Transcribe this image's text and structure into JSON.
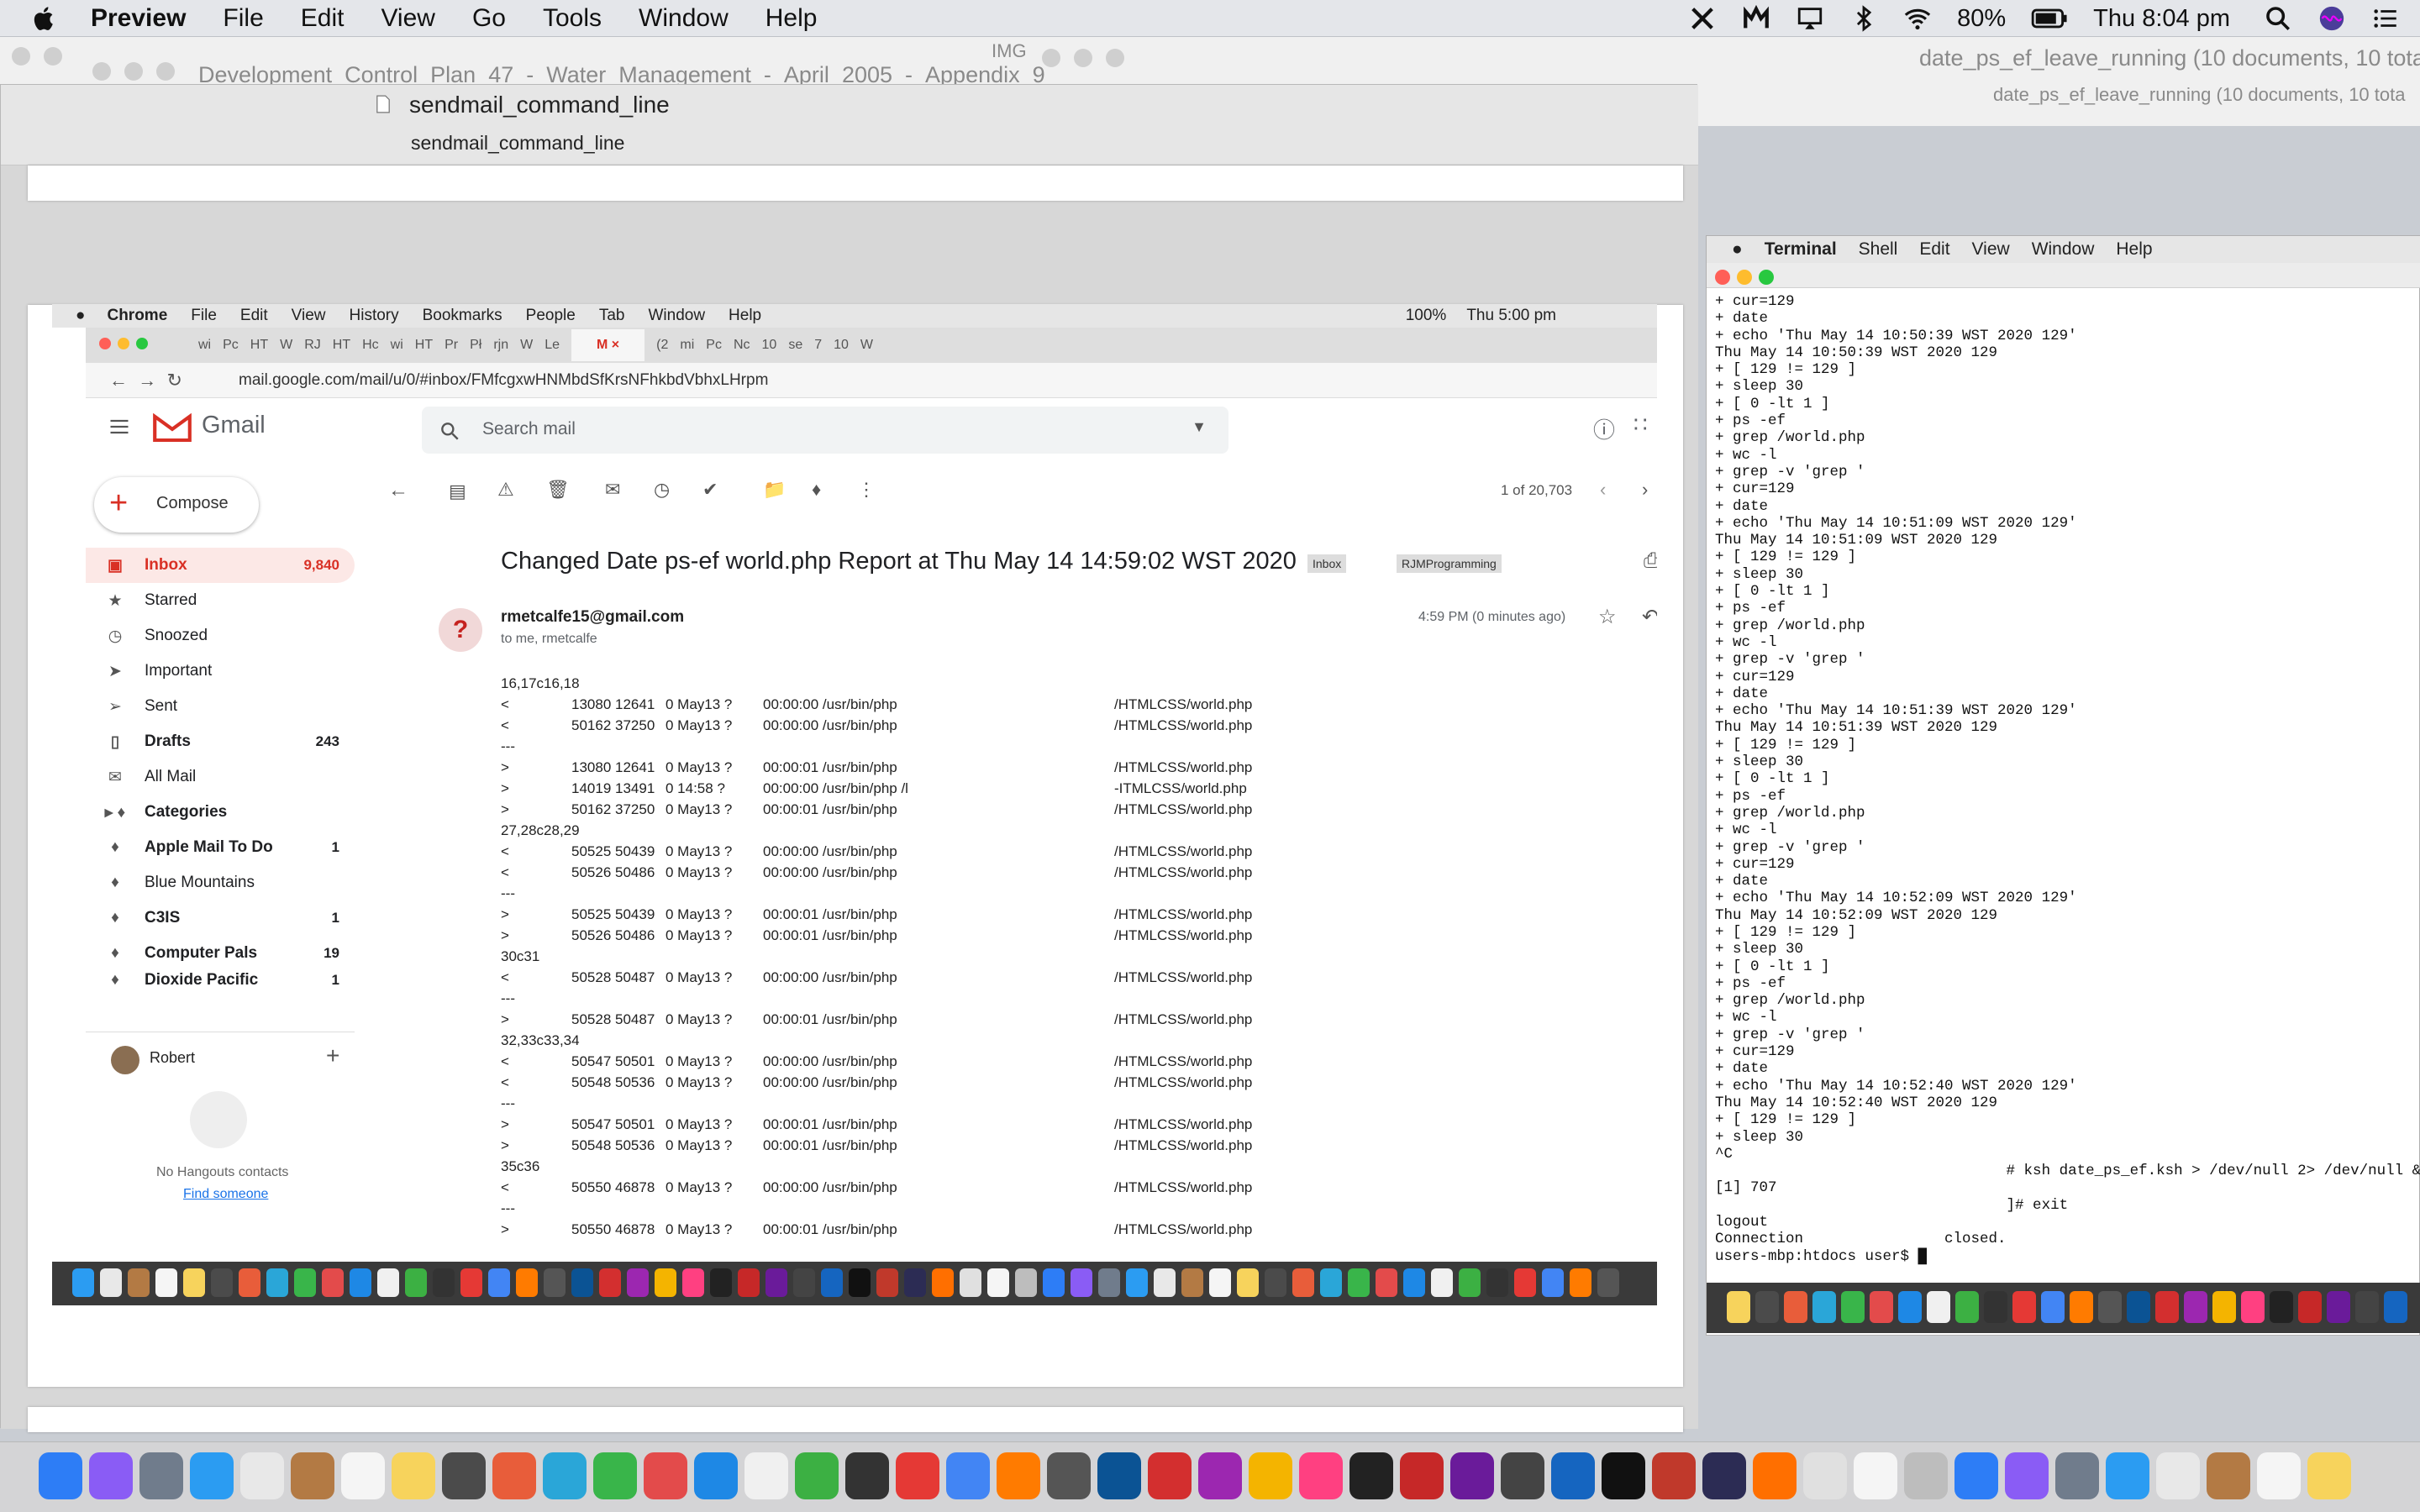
{
  "menubar": {
    "app": "Preview",
    "items": [
      "File",
      "Edit",
      "View",
      "Go",
      "Tools",
      "Window",
      "Help"
    ],
    "battery": "80%",
    "clock": "Thu 8:04 pm"
  },
  "background_windows": {
    "doc1": "Development_Control_Plan_47_-_Water_Management_-_April_2005_-_Appendix_9",
    "doc1_suffix": "IMG",
    "doc2": "date_ps_ef_leave_running (10 documents, 10 tota",
    "doc2_sub": "date_ps_ef_leave_running (10 documents, 10 tota"
  },
  "preview": {
    "title": "sendmail_command_line",
    "subtitle": "sendmail_command_line"
  },
  "inner": {
    "menubar": {
      "app": "Chrome",
      "items": [
        "File",
        "Edit",
        "View",
        "History",
        "Bookmarks",
        "People",
        "Tab",
        "Window",
        "Help"
      ],
      "battery": "100%",
      "clock": "Thu 5:00 pm"
    },
    "tabs": [
      "wi",
      "Pc",
      "HT",
      "W",
      "RJ",
      "HT",
      "Hc",
      "wi",
      "HT",
      "Pr",
      "Pł",
      "rjn",
      "W",
      "Le",
      "",
      "(2",
      "mi",
      "Pc",
      "Nc",
      "10",
      "se",
      "7",
      "10",
      "W"
    ],
    "url": "mail.google.com/mail/u/0/#inbox/FMfcgxwHNMbdSfKrsNFhkbdVbhxLHrpm",
    "gmail": {
      "logo": "Gmail",
      "search_placeholder": "Search mail",
      "compose": "Compose",
      "pager": "1 of 20,703",
      "subject": "Changed Date ps-ef world.php Report at Thu May 14 14:59:02 WST 2020",
      "labels": [
        "Inbox",
        "RJMProgramming"
      ],
      "sender": "rmetcalfe15@gmail.com",
      "to": "to me, rmetcalfe",
      "time": "4:59 PM (0 minutes ago)",
      "sidebar": [
        {
          "label": "Inbox",
          "count": "9,840",
          "icon": "inbox-icon",
          "bold": true
        },
        {
          "label": "Starred",
          "count": "",
          "icon": "star-icon"
        },
        {
          "label": "Snoozed",
          "count": "",
          "icon": "clock-icon"
        },
        {
          "label": "Important",
          "count": "",
          "icon": "important-icon"
        },
        {
          "label": "Sent",
          "count": "",
          "icon": "send-icon"
        },
        {
          "label": "Drafts",
          "count": "243",
          "icon": "draft-icon",
          "bold": true
        },
        {
          "label": "All Mail",
          "count": "",
          "icon": "allmail-icon"
        },
        {
          "label": "Categories",
          "count": "",
          "icon": "label-icon",
          "bold": true
        },
        {
          "label": "Apple Mail To Do",
          "count": "1",
          "icon": "label-icon",
          "bold": true
        },
        {
          "label": "Blue Mountains",
          "count": "",
          "icon": "label-icon"
        },
        {
          "label": "C3IS",
          "count": "1",
          "icon": "label-icon",
          "bold": true
        },
        {
          "label": "Computer Pals",
          "count": "19",
          "icon": "label-icon",
          "bold": true
        },
        {
          "label": "Dioxide Pacific",
          "count": "1",
          "icon": "label-icon",
          "bold": true
        }
      ],
      "hangouts_user": "Robert",
      "no_contacts": "No Hangouts contacts",
      "find_someone": "Find someone",
      "body": [
        [
          "16,17c16,18",
          "",
          "",
          "",
          "",
          ""
        ],
        [
          "<",
          "13080 12641",
          "0 May13 ?",
          "00:00:00 /usr/bin/php",
          "",
          "/HTMLCSS/world.php"
        ],
        [
          "<",
          "50162 37250",
          "0 May13 ?",
          "00:00:00 /usr/bin/php",
          "",
          "/HTMLCSS/world.php"
        ],
        [
          "---",
          "",
          "",
          "",
          "",
          ""
        ],
        [
          ">",
          "13080 12641",
          "0 May13 ?",
          "00:00:01 /usr/bin/php",
          "",
          "/HTMLCSS/world.php"
        ],
        [
          ">",
          "14019 13491",
          "0 14:58 ?",
          "00:00:00 /usr/bin/php /l",
          "",
          "-ITMLCSS/world.php"
        ],
        [
          ">",
          "50162 37250",
          "0 May13 ?",
          "00:00:01 /usr/bin/php",
          "",
          "/HTMLCSS/world.php"
        ],
        [
          "27,28c28,29",
          "",
          "",
          "",
          "",
          ""
        ],
        [
          "<",
          "50525 50439",
          "0 May13 ?",
          "00:00:00 /usr/bin/php",
          "",
          "/HTMLCSS/world.php"
        ],
        [
          "<",
          "50526 50486",
          "0 May13 ?",
          "00:00:00 /usr/bin/php",
          "",
          "/HTMLCSS/world.php"
        ],
        [
          "---",
          "",
          "",
          "",
          "",
          ""
        ],
        [
          ">",
          "50525 50439",
          "0 May13 ?",
          "00:00:01 /usr/bin/php",
          "",
          "/HTMLCSS/world.php"
        ],
        [
          ">",
          "50526 50486",
          "0 May13 ?",
          "00:00:01 /usr/bin/php",
          "",
          "/HTMLCSS/world.php"
        ],
        [
          "30c31",
          "",
          "",
          "",
          "",
          ""
        ],
        [
          "<",
          "50528 50487",
          "0 May13 ?",
          "00:00:00 /usr/bin/php",
          "",
          "/HTMLCSS/world.php"
        ],
        [
          "---",
          "",
          "",
          "",
          "",
          ""
        ],
        [
          ">",
          "50528 50487",
          "0 May13 ?",
          "00:00:01 /usr/bin/php",
          "",
          "/HTMLCSS/world.php"
        ],
        [
          "32,33c33,34",
          "",
          "",
          "",
          "",
          ""
        ],
        [
          "<",
          "50547 50501",
          "0 May13 ?",
          "00:00:00 /usr/bin/php",
          "",
          "/HTMLCSS/world.php"
        ],
        [
          "<",
          "50548 50536",
          "0 May13 ?",
          "00:00:00 /usr/bin/php",
          "",
          "/HTMLCSS/world.php"
        ],
        [
          "---",
          "",
          "",
          "",
          "",
          ""
        ],
        [
          ">",
          "50547 50501",
          "0 May13 ?",
          "00:00:01 /usr/bin/php",
          "",
          "/HTMLCSS/world.php"
        ],
        [
          ">",
          "50548 50536",
          "0 May13 ?",
          "00:00:01 /usr/bin/php",
          "",
          "/HTMLCSS/world.php"
        ],
        [
          "35c36",
          "",
          "",
          "",
          "",
          ""
        ],
        [
          "<",
          "50550 46878",
          "0 May13 ?",
          "00:00:00 /usr/bin/php",
          "",
          "/HTMLCSS/world.php"
        ],
        [
          "---",
          "",
          "",
          "",
          "",
          ""
        ],
        [
          ">",
          "50550 46878",
          "0 May13 ?",
          "00:00:01 /usr/bin/php",
          "",
          "/HTMLCSS/world.php"
        ]
      ]
    }
  },
  "terminal": {
    "menubar": {
      "app": "Terminal",
      "items": [
        "Shell",
        "Edit",
        "View",
        "Window",
        "Help"
      ]
    },
    "lines": [
      "+ cur=129",
      "+ date",
      "+ echo 'Thu May 14 10:50:39 WST 2020 129'",
      "Thu May 14 10:50:39 WST 2020 129",
      "+ [ 129 != 129 ]",
      "+ sleep 30",
      "+ [ 0 -lt 1 ]",
      "+ ps -ef",
      "+ grep /world.php",
      "+ wc -l",
      "+ grep -v 'grep '",
      "+ cur=129",
      "+ date",
      "+ echo 'Thu May 14 10:51:09 WST 2020 129'",
      "Thu May 14 10:51:09 WST 2020 129",
      "+ [ 129 != 129 ]",
      "+ sleep 30",
      "+ [ 0 -lt 1 ]",
      "+ ps -ef",
      "+ grep /world.php",
      "+ wc -l",
      "+ grep -v 'grep '",
      "+ cur=129",
      "+ date",
      "+ echo 'Thu May 14 10:51:39 WST 2020 129'",
      "Thu May 14 10:51:39 WST 2020 129",
      "+ [ 129 != 129 ]",
      "+ sleep 30",
      "+ [ 0 -lt 1 ]",
      "+ ps -ef",
      "+ grep /world.php",
      "+ wc -l",
      "+ grep -v 'grep '",
      "+ cur=129",
      "+ date",
      "+ echo 'Thu May 14 10:52:09 WST 2020 129'",
      "Thu May 14 10:52:09 WST 2020 129",
      "+ [ 129 != 129 ]",
      "+ sleep 30",
      "+ [ 0 -lt 1 ]",
      "+ ps -ef",
      "+ grep /world.php",
      "+ wc -l",
      "+ grep -v 'grep '",
      "+ cur=129",
      "+ date",
      "+ echo 'Thu May 14 10:52:40 WST 2020 129'",
      "Thu May 14 10:52:40 WST 2020 129",
      "+ [ 129 != 129 ]",
      "+ sleep 30",
      "^C",
      "                                 # ksh date_ps_ef.ksh > /dev/null 2> /dev/null &",
      "[1] 707",
      "                                 ]# exit",
      "logout",
      "Connection                closed.",
      "users-mbp:htdocs user$ █"
    ]
  },
  "colors": {
    "gmail_red": "#d93025",
    "inbox_highlight": "#fce8e6",
    "dock_bg": "#d4d4d6"
  }
}
